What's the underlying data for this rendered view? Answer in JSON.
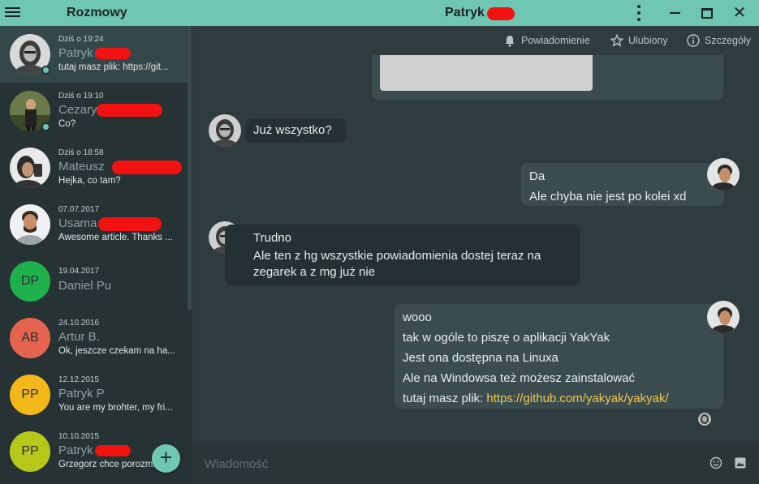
{
  "titlebar": {
    "left_title": "Rozmowy",
    "center_title": "Patryk"
  },
  "toolbar": {
    "notifications_label": "Powiadomienie",
    "favorite_label": "Ulubiony",
    "details_label": "Szczegóły"
  },
  "conversations": [
    {
      "time": "Dziś o 19:24",
      "name": "Patryk",
      "last_message": "tutaj masz plik: https://git...",
      "online": true
    },
    {
      "time": "Dziś o 19:10",
      "name": "Cezary",
      "last_message": "Co?",
      "online": true
    },
    {
      "time": "Dziś o 18:58",
      "name": "Mateusz",
      "last_message": "Hejka, co tam?"
    },
    {
      "time": "07.07.2017",
      "name": "Usama",
      "last_message": "Awesome article. Thanks ..."
    },
    {
      "time": "19.04.2017",
      "name": "Daniel Pu",
      "last_message": "",
      "initials": "DP",
      "color": "#1eb04a"
    },
    {
      "time": "24.10.2016",
      "name": "Artur B.",
      "last_message": "Ok, jeszcze czekam na ha...",
      "initials": "AB",
      "color": "#e46450"
    },
    {
      "time": "12.12.2015",
      "name": "Patryk P",
      "last_message": "You are my brohter, my fri...",
      "initials": "PP",
      "color": "#f2b81a"
    },
    {
      "time": "10.10.2015",
      "name": "Patryk",
      "last_message": "Grzegorz chce porozm...",
      "initials": "PP",
      "color": "#b8c81a"
    }
  ],
  "messages": [
    {
      "from": "them",
      "lines": [
        "Już wszystko?"
      ]
    },
    {
      "from": "me",
      "lines": [
        "Da",
        "Ale chyba nie jest po kolei xd"
      ]
    },
    {
      "from": "them",
      "lines": [
        "Trudno",
        "Ale ten z hg wszystkie powiadomienia dostej teraz na",
        "zegarek a z mg już nie"
      ]
    },
    {
      "from": "me",
      "lines": [
        "wooo",
        "tak w ogóle to piszę o aplikacji YakYak",
        "Jest ona dostępna na Linuxa",
        "Ale na Windowsa też możesz zainstalować"
      ],
      "prefix": "tutaj masz plik: ",
      "link": "https://github.com/yakyak/yakyak/"
    }
  ],
  "composer": {
    "placeholder": "Wiadomość"
  },
  "colors": {
    "accent": "#6fc7b3",
    "sidebar": "#273235",
    "chat_bg": "#2f3c3f",
    "link": "#f2c94c",
    "redaction": "#f21212"
  }
}
